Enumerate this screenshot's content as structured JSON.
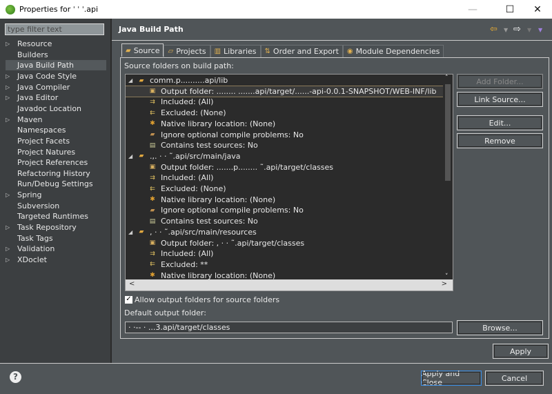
{
  "window": {
    "title": "Properties for ˈ      ˈ    ˈ.api",
    "minimize": "—",
    "maximize": "☐",
    "close": "✕"
  },
  "sidebar": {
    "filter_placeholder": "type filter text",
    "items": [
      {
        "label": "Resource",
        "expandable": true
      },
      {
        "label": "Builders",
        "expandable": false
      },
      {
        "label": "Java Build Path",
        "expandable": false,
        "selected": true
      },
      {
        "label": "Java Code Style",
        "expandable": true
      },
      {
        "label": "Java Compiler",
        "expandable": true
      },
      {
        "label": "Java Editor",
        "expandable": true
      },
      {
        "label": "Javadoc Location",
        "expandable": false
      },
      {
        "label": "Maven",
        "expandable": true
      },
      {
        "label": "Namespaces",
        "expandable": false
      },
      {
        "label": "Project Facets",
        "expandable": false
      },
      {
        "label": "Project Natures",
        "expandable": false
      },
      {
        "label": "Project References",
        "expandable": false
      },
      {
        "label": "Refactoring History",
        "expandable": false
      },
      {
        "label": "Run/Debug Settings",
        "expandable": false
      },
      {
        "label": "Spring",
        "expandable": true
      },
      {
        "label": "Subversion",
        "expandable": false
      },
      {
        "label": "Targeted Runtimes",
        "expandable": false
      },
      {
        "label": "Task Repository",
        "expandable": true
      },
      {
        "label": "Task Tags",
        "expandable": false
      },
      {
        "label": "Validation",
        "expandable": true
      },
      {
        "label": "XDoclet",
        "expandable": true
      }
    ]
  },
  "header": {
    "title": "Java Build Path"
  },
  "tabs": [
    {
      "label": "Source",
      "icon": "source-folder-icon",
      "active": true
    },
    {
      "label": "Projects",
      "icon": "projects-icon"
    },
    {
      "label": "Libraries",
      "icon": "libraries-icon"
    },
    {
      "label": "Order and Export",
      "icon": "order-export-icon"
    },
    {
      "label": "Module Dependencies",
      "icon": "module-icon"
    }
  ],
  "source": {
    "label": "Source folders on build path:",
    "rows": [
      {
        "level": 0,
        "text": "comm.p..........api/lib",
        "icon": "folder"
      },
      {
        "level": 1,
        "text": "Output folder:  ........ .......api/target/......-api-0.0.1-SNAPSHOT/WEB-INF/lib",
        "icon": "output",
        "selected": true
      },
      {
        "level": 1,
        "text": "Included: (All)",
        "icon": "included"
      },
      {
        "level": 1,
        "text": "Excluded: (None)",
        "icon": "excluded"
      },
      {
        "level": 1,
        "text": "Native library location: (None)",
        "icon": "native"
      },
      {
        "level": 1,
        "text": "Ignore optional compile problems: No",
        "icon": "ignore"
      },
      {
        "level": 1,
        "text": "Contains test sources: No",
        "icon": "test"
      },
      {
        "level": 0,
        "text": "  .,. ·   ·    ˜.api/src/main/java",
        "icon": "folder"
      },
      {
        "level": 1,
        "text": "Output folder: .......p........    ˜.api/target/classes",
        "icon": "output"
      },
      {
        "level": 1,
        "text": "Included: (All)",
        "icon": "included"
      },
      {
        "level": 1,
        "text": "Excluded: (None)",
        "icon": "excluded"
      },
      {
        "level": 1,
        "text": "Native library location: (None)",
        "icon": "native"
      },
      {
        "level": 1,
        "text": "Ignore optional compile problems: No",
        "icon": "ignore"
      },
      {
        "level": 1,
        "text": "Contains test sources: No",
        "icon": "test"
      },
      {
        "level": 0,
        "text": "     ,   ·  ·    ˜.api/src/main/resources",
        "icon": "folder"
      },
      {
        "level": 1,
        "text": "Output folder:          ,   ·  ·    ˜.api/target/classes",
        "icon": "output"
      },
      {
        "level": 1,
        "text": "Included: (All)",
        "icon": "included"
      },
      {
        "level": 1,
        "text": "Excluded: **",
        "icon": "excluded"
      },
      {
        "level": 1,
        "text": "Native library location: (None)",
        "icon": "native"
      }
    ]
  },
  "buttons": {
    "add_folder": "Add Folder...",
    "link_source": "Link Source...",
    "edit": "Edit...",
    "remove": "Remove",
    "browse": "Browse...",
    "apply": "Apply",
    "apply_close": "Apply and Close",
    "cancel": "Cancel"
  },
  "allow_output": {
    "label": "Allow output folders for source folders",
    "checked": true
  },
  "default_output": {
    "label": "Default output folder:",
    "value": "·  ·--       ·  ...3.api/target/classes"
  },
  "help": "?"
}
